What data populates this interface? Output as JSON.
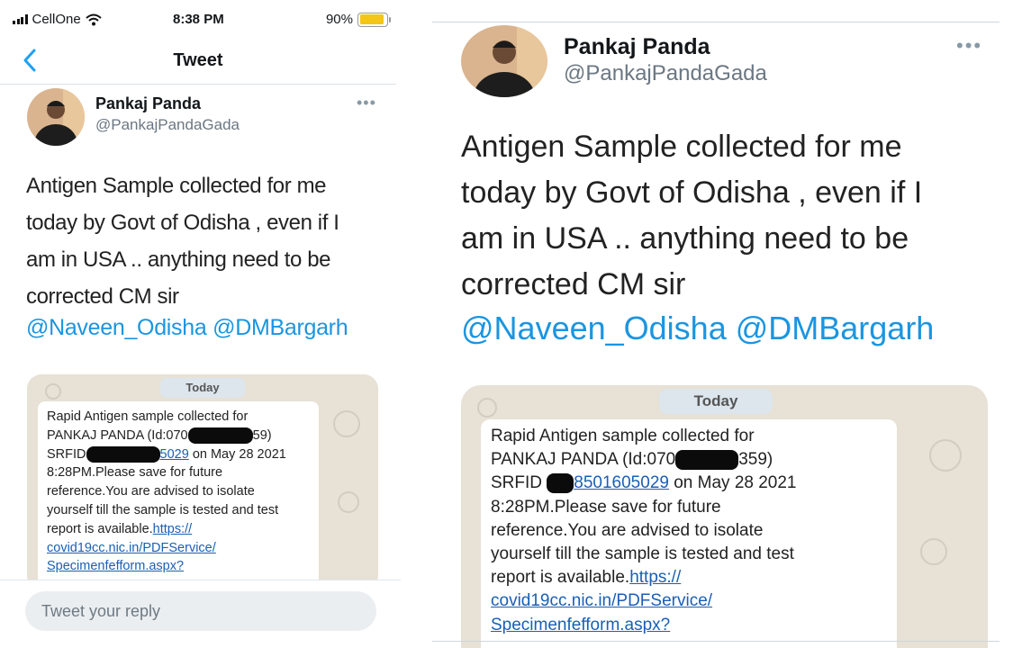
{
  "status_bar": {
    "carrier": "CellOne",
    "time": "8:38 PM",
    "battery": "90%",
    "battery_level": 0.9,
    "battery_color": "#f5c518"
  },
  "nav": {
    "back_icon": "chevron-left-icon",
    "title": "Tweet"
  },
  "tweet": {
    "name": "Pankaj Panda",
    "handle": "@PankajPandaGada",
    "more_icon": "more-horizontal-icon",
    "text_lines": [
      "Antigen Sample collected for me",
      "today by Govt of Odisha , even if I",
      "am in USA .. anything need to be",
      "corrected CM sir"
    ],
    "mentions": "@Naveen_Odisha @DMBargarh",
    "mention_color": "#1b95e0"
  },
  "sms": {
    "date_badge": "Today",
    "left_lines": {
      "l1": "Rapid Antigen sample collected for",
      "l2a": "PANKAJ PANDA (Id:070",
      "l2b": "59)",
      "l3a": "SRFID ",
      "l3link": "5029",
      "l3b": " on May 28 2021",
      "l4": "8:28PM.Please save for future",
      "l5": "reference.You are advised to isolate",
      "l6": "yourself till the sample is tested and test",
      "l7a": "report is available.",
      "l7link": "https://",
      "l8link": "covid19cc.nic.in/PDFService/",
      "l9link": "Specimenfefform.aspx?"
    },
    "right_lines": {
      "l1": "Rapid Antigen sample collected for",
      "l2a": "PANKAJ PANDA (Id:070",
      "l2b": "359)",
      "l3a": "SRFID ",
      "l3link": "8501605029",
      "l3b": "  on May 28 2021",
      "l4": "8:28PM.Please save for future",
      "l5": "reference.You are advised to isolate",
      "l6": "yourself till the sample is tested and test",
      "l7a": "report is available.",
      "l7link": "https://",
      "l8link": "covid19cc.nic.in/PDFService/",
      "l9link": "Specimenfefform.aspx?"
    }
  },
  "reply": {
    "placeholder": "Tweet your reply"
  }
}
